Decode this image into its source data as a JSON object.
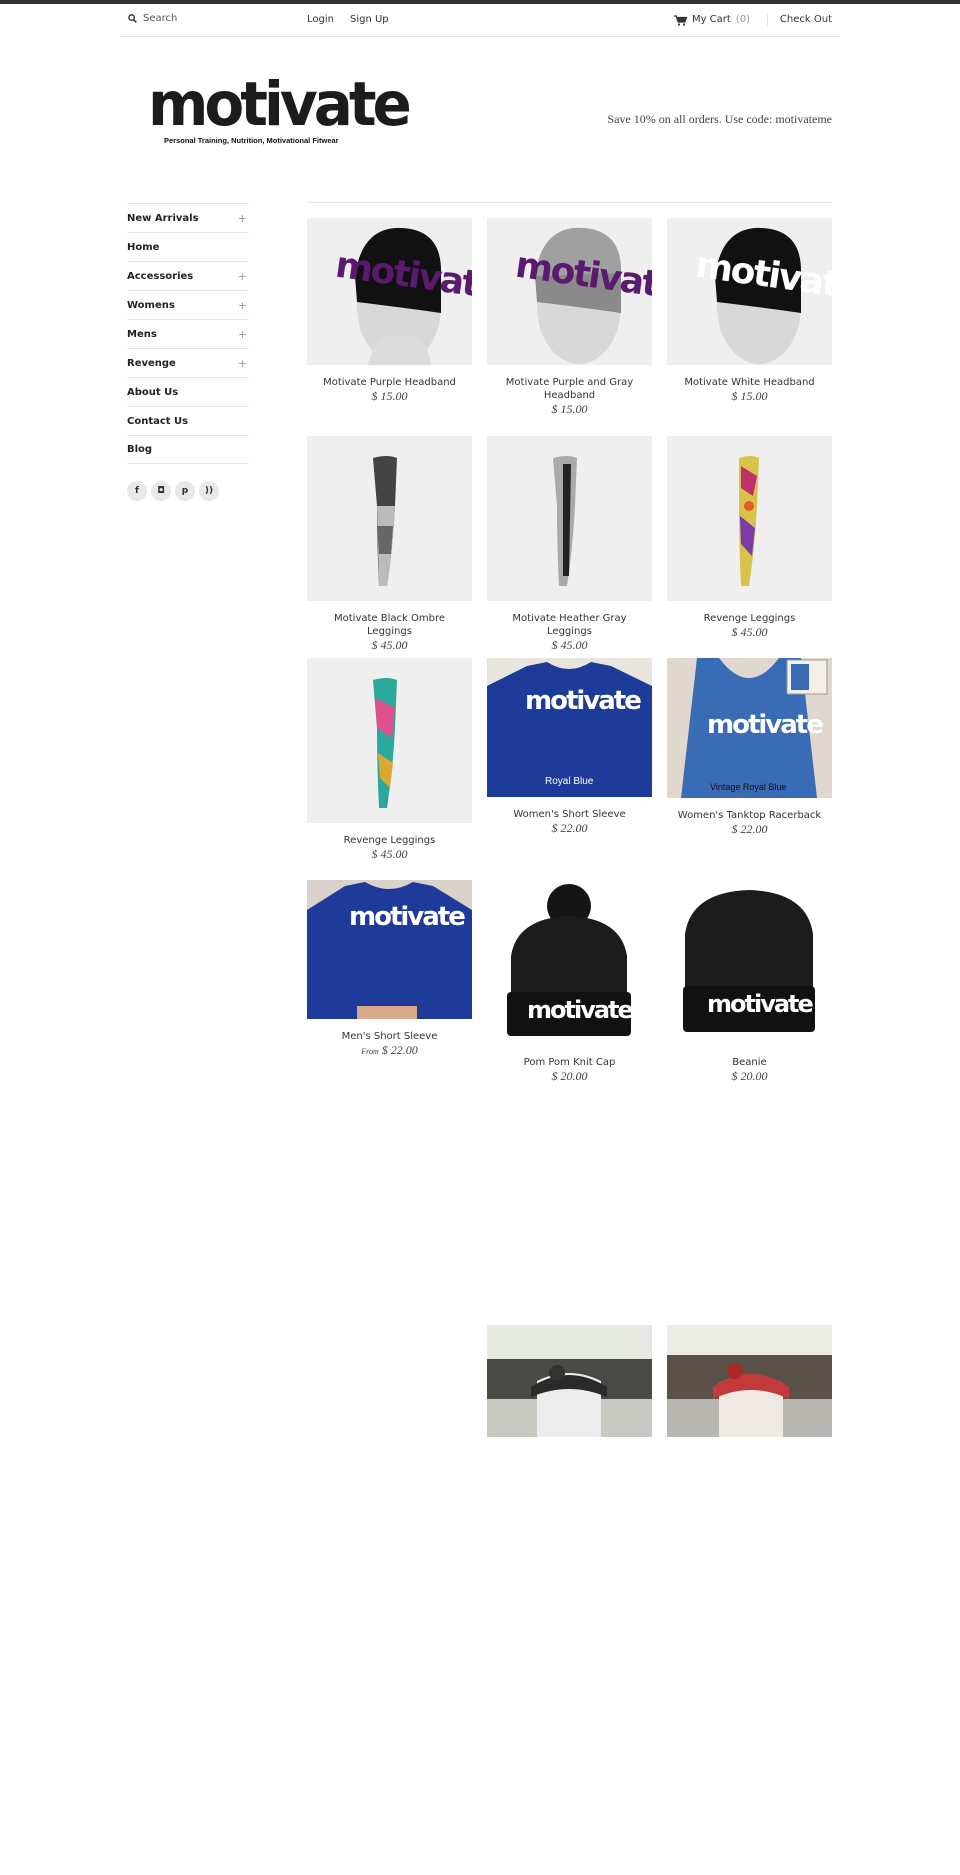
{
  "header": {
    "search_placeholder": "Search",
    "login": "Login",
    "signup": "Sign Up",
    "cart_label": "My Cart",
    "cart_count": "(0)",
    "checkout": "Check Out"
  },
  "logo": {
    "wordmark": "motivate",
    "tagline": "Personal Training, Nutrition, Motivational Fitwear"
  },
  "promo": "Save 10% on all orders. Use code: motivateme",
  "nav": [
    {
      "label": "New Arrivals",
      "expand": "+"
    },
    {
      "label": "Home",
      "expand": ""
    },
    {
      "label": "Accessories",
      "expand": "+"
    },
    {
      "label": "Womens",
      "expand": "+"
    },
    {
      "label": "Mens",
      "expand": "+"
    },
    {
      "label": "Revenge",
      "expand": "+"
    },
    {
      "label": "About Us",
      "expand": ""
    },
    {
      "label": "Contact Us",
      "expand": ""
    },
    {
      "label": "Blog",
      "expand": ""
    }
  ],
  "social": [
    "facebook-icon",
    "instagram-icon",
    "pinterest-icon",
    "rss-icon"
  ],
  "products": [
    {
      "title": "Motivate Purple Headband",
      "price": "$ 15.00",
      "from": ""
    },
    {
      "title": "Motivate Purple and Gray Headband",
      "price": "$ 15.00",
      "from": ""
    },
    {
      "title": "Motivate White Headband",
      "price": "$ 15.00",
      "from": ""
    },
    {
      "title": "Motivate Black Ombre Leggings",
      "price": "$ 45.00",
      "from": ""
    },
    {
      "title": "Motivate Heather Gray Leggings",
      "price": "$ 45.00",
      "from": ""
    },
    {
      "title": "Revenge Leggings",
      "price": "$ 45.00",
      "from": ""
    },
    {
      "title": "Revenge Leggings",
      "price": "$ 45.00",
      "from": ""
    },
    {
      "title": "Women's Short Sleeve",
      "price": "$ 22.00",
      "from": ""
    },
    {
      "title": "Women's Tanktop Racerback",
      "price": "$ 22.00",
      "from": ""
    },
    {
      "title": "Men's Short Sleeve",
      "price": "$ 22.00",
      "from": "From"
    },
    {
      "title": "Pom Pom Knit Cap",
      "price": "$ 20.00",
      "from": ""
    },
    {
      "title": "Beanie",
      "price": "$ 20.00",
      "from": ""
    }
  ],
  "image_text": {
    "wordmark": "motivate",
    "royal_blue": "Royal Blue",
    "vintage_royal_blue": "Vintage Royal Blue"
  },
  "colors": {
    "accent_purple": "#5a1a6e",
    "royal_blue": "#1f3b9a",
    "vintage_blue": "#3a6bb5",
    "dark": "#1c1c1c"
  }
}
